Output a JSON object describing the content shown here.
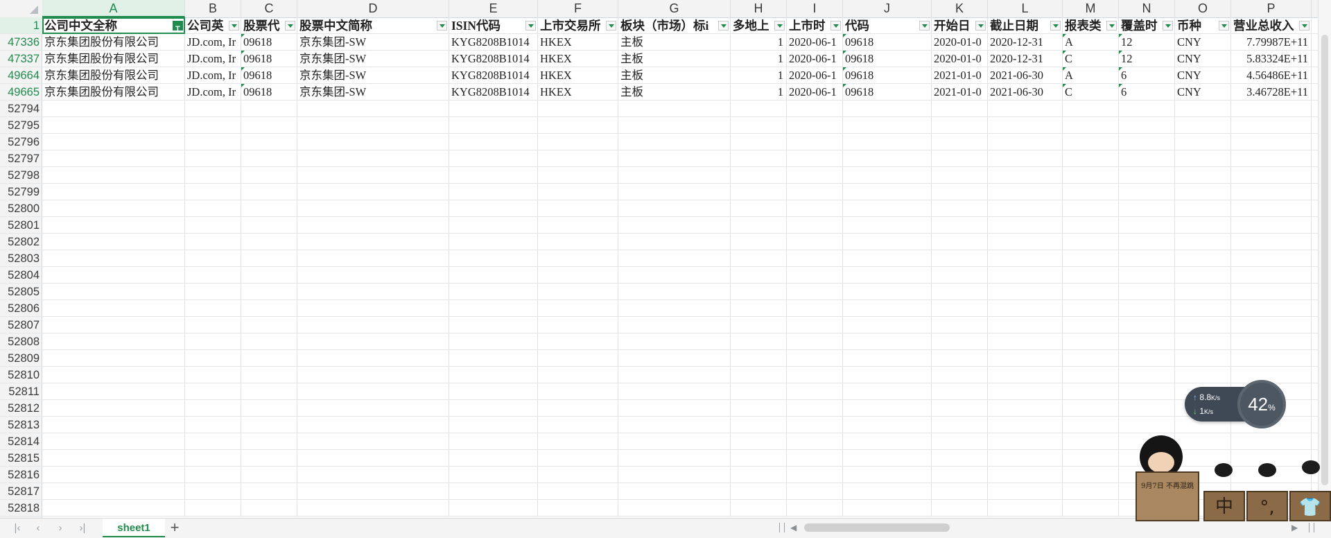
{
  "spreadsheet": {
    "columns": [
      {
        "letter": "A",
        "header": "公司中文全称"
      },
      {
        "letter": "B",
        "header": "公司英"
      },
      {
        "letter": "C",
        "header": "股票代"
      },
      {
        "letter": "D",
        "header": "股票中文简称"
      },
      {
        "letter": "E",
        "header": "ISIN代码"
      },
      {
        "letter": "F",
        "header": "上市交易所"
      },
      {
        "letter": "G",
        "header": "板块（市场）标i"
      },
      {
        "letter": "H",
        "header": "多地上"
      },
      {
        "letter": "I",
        "header": "上市时"
      },
      {
        "letter": "J",
        "header": "代码"
      },
      {
        "letter": "K",
        "header": "开始日"
      },
      {
        "letter": "L",
        "header": "截止日期"
      },
      {
        "letter": "M",
        "header": "报表类"
      },
      {
        "letter": "N",
        "header": "覆盖时"
      },
      {
        "letter": "O",
        "header": "币种"
      },
      {
        "letter": "P",
        "header": "营业总收入"
      }
    ],
    "header_row_number": "1",
    "selected_cell": "A1",
    "data_rows": [
      {
        "row_number": "47336",
        "cells": [
          "京东集团股份有限公司",
          "JD.com, Ir",
          "09618",
          "京东集团-SW",
          "KYG8208B1014",
          "HKEX",
          "主板",
          "1",
          "2020-06-1",
          "09618",
          "2020-01-0",
          "2020-12-31",
          "A",
          "12",
          "CNY",
          "7.79987E+11"
        ]
      },
      {
        "row_number": "47337",
        "cells": [
          "京东集团股份有限公司",
          "JD.com, Ir",
          "09618",
          "京东集团-SW",
          "KYG8208B1014",
          "HKEX",
          "主板",
          "1",
          "2020-06-1",
          "09618",
          "2020-01-0",
          "2020-12-31",
          "C",
          "12",
          "CNY",
          "5.83324E+11"
        ]
      },
      {
        "row_number": "49664",
        "cells": [
          "京东集团股份有限公司",
          "JD.com, Ir",
          "09618",
          "京东集团-SW",
          "KYG8208B1014",
          "HKEX",
          "主板",
          "1",
          "2020-06-1",
          "09618",
          "2021-01-0",
          "2021-06-30",
          "A",
          "6",
          "CNY",
          "4.56486E+11"
        ]
      },
      {
        "row_number": "49665",
        "cells": [
          "京东集团股份有限公司",
          "JD.com, Ir",
          "09618",
          "京东集团-SW",
          "KYG8208B1014",
          "HKEX",
          "主板",
          "1",
          "2020-06-1",
          "09618",
          "2021-01-0",
          "2021-06-30",
          "C",
          "6",
          "CNY",
          "3.46728E+11"
        ]
      }
    ],
    "empty_row_numbers": [
      "52794",
      "52795",
      "52796",
      "52797",
      "52798",
      "52799",
      "52800",
      "52801",
      "52802",
      "52803",
      "52804",
      "52805",
      "52806",
      "52807",
      "52808",
      "52809",
      "52810",
      "52811",
      "52812",
      "52813",
      "52814",
      "52815",
      "52816",
      "52817",
      "52818"
    ]
  },
  "sheet_tabs": {
    "tabs": [
      "sheet1"
    ],
    "active": "sheet1",
    "add_label": "+"
  },
  "network_widget": {
    "upload": "8.8",
    "upload_unit": "K/s",
    "download": "1",
    "download_unit": "K/s",
    "cpu_percent": "42",
    "percent_sign": "%"
  },
  "desktop_pet": {
    "sign_text": "9月7日 不再混跳",
    "box_glyphs": [
      "中",
      "°,",
      "👕"
    ]
  },
  "colors": {
    "accent": "#1f8b4c",
    "header_bg": "#f3f3f3",
    "grid_line": "#e3e6e9"
  }
}
